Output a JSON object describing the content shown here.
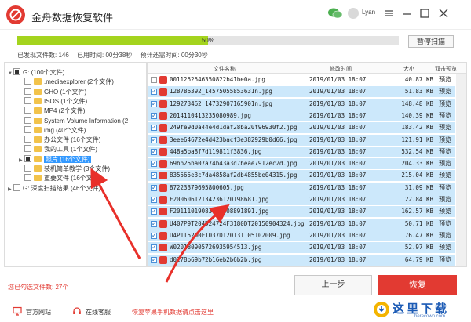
{
  "window": {
    "title": "金舟数据恢复软件",
    "username": "Lyan"
  },
  "scan": {
    "progress_percent": 50,
    "progress_label": "50%",
    "pause_label": "暂停扫描",
    "files_found": "已发现文件数: 146",
    "elapsed": "已用时间: 00分38秒",
    "remaining": "预计还需时间: 00分30秒"
  },
  "tree": [
    {
      "indent": 0,
      "expander": "▼",
      "check": "partial",
      "folder": false,
      "label": "G:  (100个文件)",
      "selected": false
    },
    {
      "indent": 1,
      "expander": "",
      "check": "none",
      "folder": true,
      "label": ".mediaexplorer  (2个文件)",
      "selected": false
    },
    {
      "indent": 1,
      "expander": "",
      "check": "none",
      "folder": true,
      "label": "GHO  (1个文件)",
      "selected": false
    },
    {
      "indent": 1,
      "expander": "",
      "check": "none",
      "folder": true,
      "label": "ISOS  (1个文件)",
      "selected": false
    },
    {
      "indent": 1,
      "expander": "",
      "check": "none",
      "folder": true,
      "label": "MP4  (2个文件)",
      "selected": false
    },
    {
      "indent": 1,
      "expander": "",
      "check": "none",
      "folder": true,
      "label": "System Volume Information  (2",
      "selected": false
    },
    {
      "indent": 1,
      "expander": "",
      "check": "none",
      "folder": true,
      "label": "img  (40个文件)",
      "selected": false
    },
    {
      "indent": 1,
      "expander": "",
      "check": "none",
      "folder": true,
      "label": "办公文件  (16个文件)",
      "selected": false
    },
    {
      "indent": 1,
      "expander": "",
      "check": "none",
      "folder": true,
      "label": "我的工具  (1个文件)",
      "selected": false
    },
    {
      "indent": 1,
      "expander": "▶",
      "check": "partial",
      "folder": true,
      "label": "照片  (16个文件)",
      "selected": true
    },
    {
      "indent": 1,
      "expander": "",
      "check": "none",
      "folder": true,
      "label": "装机简单教学  (3个文件)",
      "selected": false
    },
    {
      "indent": 1,
      "expander": "",
      "check": "none",
      "folder": true,
      "label": "重要文件  (16个文件)",
      "selected": false
    },
    {
      "indent": 0,
      "expander": "▶",
      "check": "none",
      "folder": false,
      "label": "G: 深度扫描结果  (46个文件)",
      "selected": false
    }
  ],
  "list": {
    "headers": {
      "name": "文件名称",
      "date": "修改时间",
      "size": "大小",
      "preview": "双击预览"
    },
    "rows": [
      {
        "name": "0011252546350822b41be0a.jpg",
        "date": "2019/01/03 18:07",
        "size": "40.87 KB",
        "preview": "预览",
        "checked": false
      },
      {
        "name": "128786392_14575055853631n.jpg",
        "date": "2019/01/03 18:07",
        "size": "51.83 KB",
        "preview": "预览",
        "checked": true
      },
      {
        "name": "129273462_14732907165901n.jpg",
        "date": "2019/01/03 18:07",
        "size": "148.48 KB",
        "preview": "预览",
        "checked": true
      },
      {
        "name": "2014110413235080989.jpg",
        "date": "2019/01/03 18:07",
        "size": "140.39 KB",
        "preview": "预览",
        "checked": true
      },
      {
        "name": "249fe9d0a44e4d1daf28ba20f96930f2.jpg",
        "date": "2019/01/03 18:07",
        "size": "183.42 KB",
        "preview": "预览",
        "checked": true
      },
      {
        "name": "3eee64672e4d423bacf3e382929b0d66.jpg",
        "date": "2019/01/03 18:07",
        "size": "121.91 KB",
        "preview": "预览",
        "checked": true
      },
      {
        "name": "448a5ba8f7d119811f3836.jpg",
        "date": "2019/01/03 18:07",
        "size": "532.54 KB",
        "preview": "预览",
        "checked": true
      },
      {
        "name": "69bb25ba07a74b43a3d7beae7912ec2d.jpg",
        "date": "2019/01/03 18:07",
        "size": "204.33 KB",
        "preview": "预览",
        "checked": true
      },
      {
        "name": "835565e3c7da4858af2db4855be04315.jpg",
        "date": "2019/01/03 18:07",
        "size": "215.04 KB",
        "preview": "预览",
        "checked": true
      },
      {
        "name": "87223379695800605.jpg",
        "date": "2019/01/03 18:07",
        "size": "31.09 KB",
        "preview": "预览",
        "checked": true
      },
      {
        "name": "F20060612134236120198681.jpg",
        "date": "2019/01/03 18:07",
        "size": "22.84 KB",
        "preview": "预览",
        "checked": true
      },
      {
        "name": "F20111019083458208891891.jpg",
        "date": "2019/01/03 18:07",
        "size": "162.57 KB",
        "preview": "预览",
        "checked": true
      },
      {
        "name": "U407P9T204D24724F3180DT20150904324.jpg",
        "date": "2019/01/03 18:07",
        "size": "50.71 KB",
        "preview": "预览",
        "checked": true
      },
      {
        "name": "U4P1T52D0F1037DT20131105102009.jpg",
        "date": "2019/01/03 18:07",
        "size": "76.47 KB",
        "preview": "预览",
        "checked": true
      },
      {
        "name": "W020180905726935954513.jpg",
        "date": "2019/01/03 18:07",
        "size": "52.97 KB",
        "preview": "预览",
        "checked": true
      },
      {
        "name": "d0278b69b72b16eb2b6b2b.jpg",
        "date": "2019/01/03 18:07",
        "size": "64.79 KB",
        "preview": "预览",
        "checked": true
      }
    ]
  },
  "footer": {
    "selected_count": "您已勾选文件数: 27个",
    "prev_label": "上一步",
    "recover_label": "恢复",
    "official_site": "官方网站",
    "online_service": "在线客服",
    "promo": "恢复苹果手机数据请点击这里"
  },
  "watermark": {
    "text": "这里下载",
    "sub": "herecown.com"
  },
  "colors": {
    "accent": "#e23a32",
    "progress": "#a4d41e",
    "row_selected": "#cce8fb",
    "tree_selected": "#3399ff"
  }
}
